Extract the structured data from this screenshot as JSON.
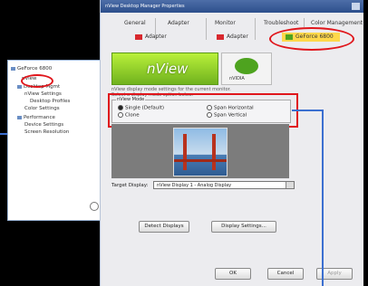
{
  "tree": {
    "root": "GeForce 6800",
    "items": [
      "nView",
      "Desktop Mgmt",
      "nView Settings",
      "Desktop Profiles",
      "Color Settings",
      "Performance",
      "Device Settings",
      "Screen Resolution"
    ]
  },
  "dialog": {
    "title": "nView Desktop Manager Properties",
    "tabs_row1": [
      "General",
      "Adapter",
      "Monitor",
      "Troubleshoot",
      "Color Management"
    ],
    "tabs_row2": [
      "Adapter",
      "Adapter",
      "GeForce 6800"
    ],
    "banner": {
      "logo": "nView",
      "caption": "nVIDIA"
    },
    "description": [
      "nView display mode settings for the current monitor.",
      "Select a display mode option below."
    ],
    "display_mode_group": {
      "title": "nView Mode",
      "options": [
        {
          "label": "Single (Default)",
          "selected": true
        },
        {
          "label": "Clone",
          "selected": false
        },
        {
          "label": "Span Horizontal",
          "selected": false
        },
        {
          "label": "Span Vertical",
          "selected": false
        }
      ]
    },
    "target_display": {
      "label": "Target Display:",
      "value": "nView Display 1 - Analog Display"
    },
    "bottom_buttons": [
      "Detect Displays",
      "Display Settings..."
    ],
    "dialog_buttons": [
      "OK",
      "Cancel",
      "Apply"
    ]
  }
}
